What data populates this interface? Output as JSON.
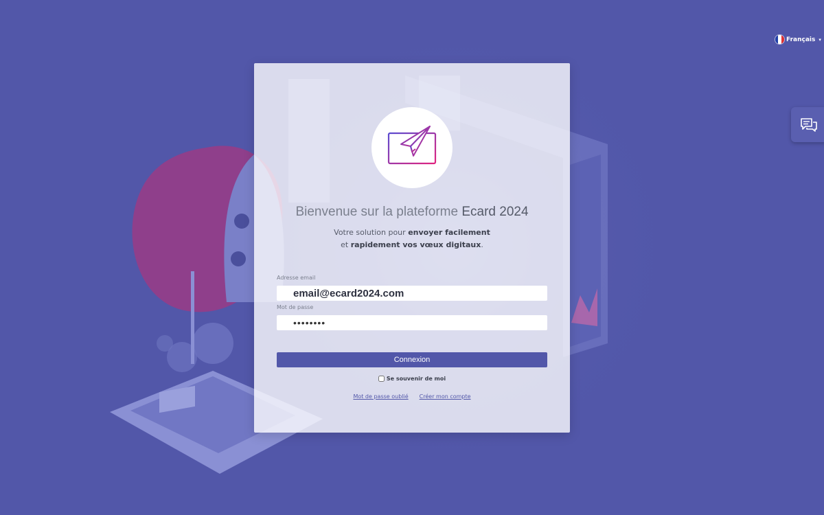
{
  "language": {
    "label": "Français",
    "caret": "▾",
    "flag_colors": [
      "#1f3fa8",
      "#ffffff",
      "#e03131"
    ]
  },
  "chat": {
    "icon": "chat-bubbles-icon"
  },
  "logo": {
    "icon": "paper-plane-monitor-icon",
    "gradient": [
      "#5b4bd0",
      "#e0237f"
    ]
  },
  "welcome": {
    "prefix": "Bienvenue sur la plateforme ",
    "brand": "Ecard 2024"
  },
  "tagline": {
    "part1": "Votre solution pour ",
    "bold1": "envoyer facilement",
    "part2": "et ",
    "bold2": "rapidement vos vœux digitaux",
    "end": "."
  },
  "form": {
    "email_label": "Adresse email",
    "email_value": "email@ecard2024.com",
    "password_label": "Mot de passe",
    "password_value": "passw0rd",
    "submit_label": "Connexion",
    "remember_label": "Se souvenir de moi",
    "forgot_link": "Mot de passe oublié",
    "create_link": "Créer mon compte"
  },
  "colors": {
    "background": "#5257a9",
    "primary": "#5257a9",
    "card": "#ffffff"
  }
}
